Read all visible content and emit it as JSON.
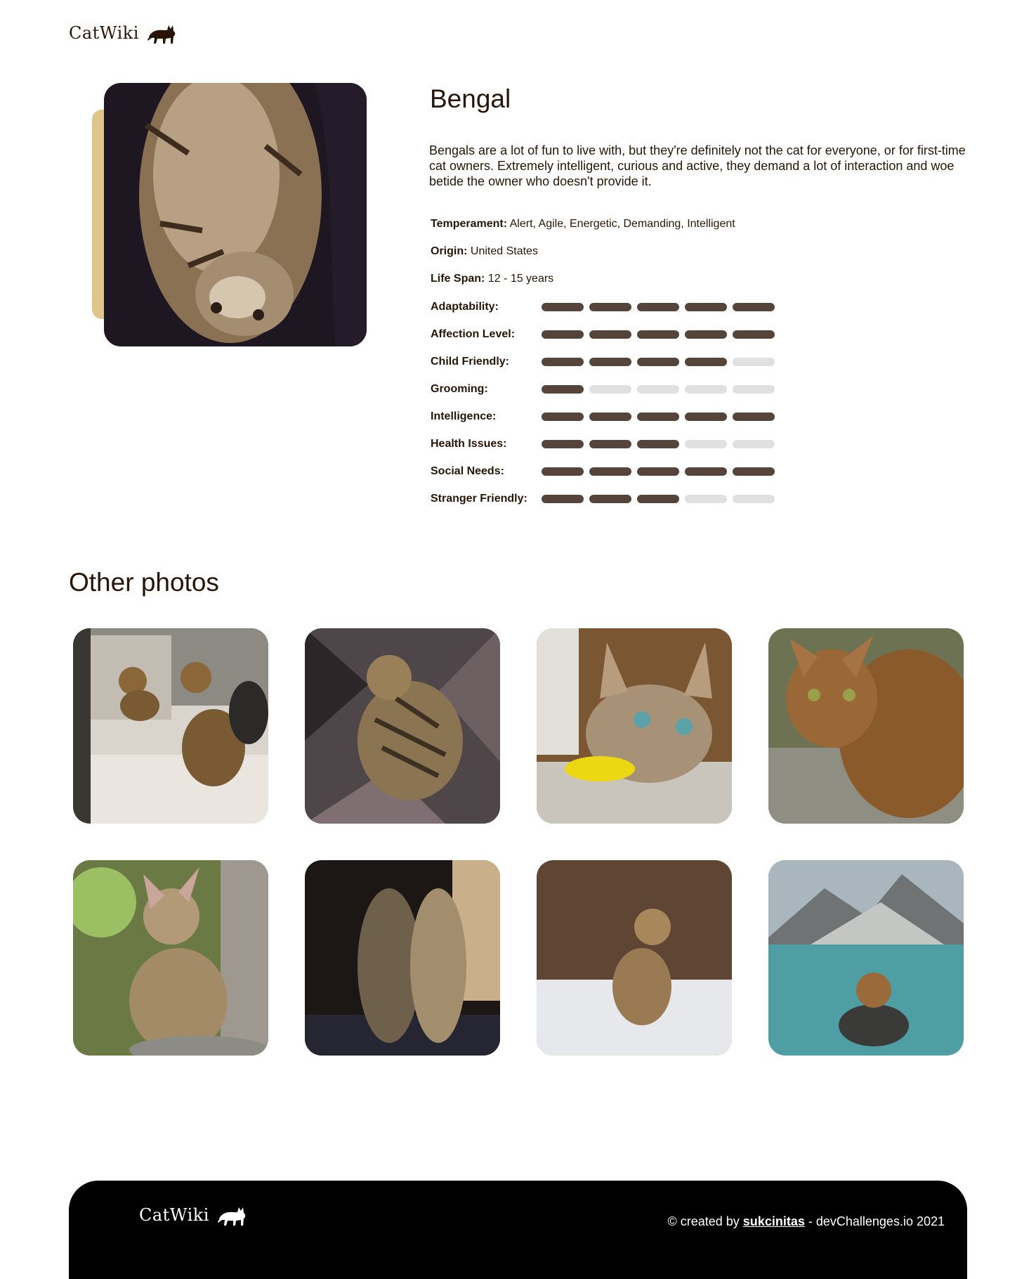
{
  "header": {
    "logo_text": "CatWiki"
  },
  "breed": {
    "name": "Bengal",
    "description": "Bengals are a lot of fun to live with, but they're definitely not the cat for everyone, or for first-time cat owners. Extremely intelligent, curious and active, they demand a lot of interaction and woe betide the owner who doesn't provide it.",
    "temperament_label": "Temperament:",
    "temperament": "Alert, Agile, Energetic, Demanding, Intelligent",
    "origin_label": "Origin:",
    "origin": "United States",
    "life_span_label": "Life Span:",
    "life_span": "12 - 15 years",
    "ratings": [
      {
        "label": "Adaptability:",
        "value": 5,
        "max": 5
      },
      {
        "label": "Affection Level:",
        "value": 5,
        "max": 5
      },
      {
        "label": "Child Friendly:",
        "value": 4,
        "max": 5
      },
      {
        "label": "Grooming:",
        "value": 1,
        "max": 5
      },
      {
        "label": "Intelligence:",
        "value": 5,
        "max": 5
      },
      {
        "label": "Health Issues:",
        "value": 3,
        "max": 5
      },
      {
        "label": "Social Needs:",
        "value": 5,
        "max": 5
      },
      {
        "label": "Stranger Friendly:",
        "value": 3,
        "max": 5
      }
    ]
  },
  "other_photos": {
    "title": "Other photos",
    "count": 8
  },
  "footer": {
    "logo_text": "CatWiki",
    "credit_prefix": "© created by",
    "author": "sukcinitas",
    "credit_suffix": "- devChallenges.io 2021"
  },
  "colors": {
    "text": "#291507",
    "bar_on": "#544439",
    "bar_off": "#E0E0E0",
    "accent": "#DEC68B",
    "footer_bg": "#000000"
  }
}
